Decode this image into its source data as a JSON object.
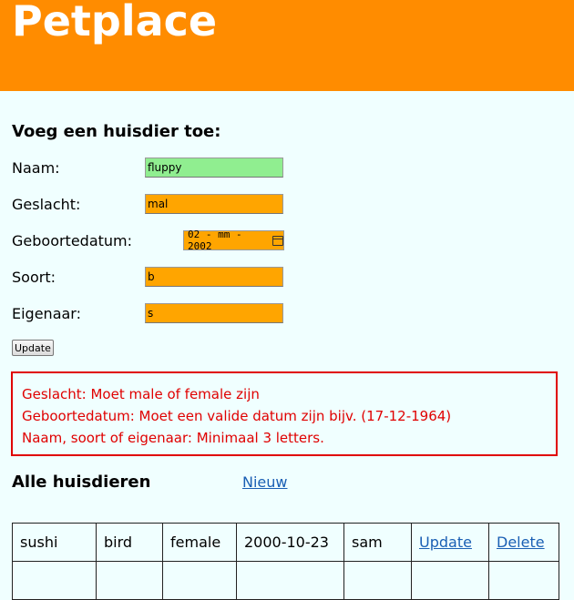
{
  "header": {
    "title": "Petplace"
  },
  "form": {
    "title": "Voeg een huisdier toe:",
    "fields": [
      {
        "label": "Naam:",
        "value": "fluppy",
        "valid": true
      },
      {
        "label": "Geslacht:",
        "value": "mal",
        "valid": false
      },
      {
        "label": "Geboortedatum:",
        "value": "02 - mm - 2002",
        "valid": false
      },
      {
        "label": "Soort:",
        "value": "b",
        "valid": false
      },
      {
        "label": "Eigenaar:",
        "value": "s",
        "valid": false
      }
    ],
    "submit_label": "Update"
  },
  "errors": [
    "Geslacht: Moet male of female zijn",
    "Geboortedatum: Moet een valide datum zijn bijv. (17-12-1964)",
    "Naam, soort of eigenaar: Minimaal 3 letters."
  ],
  "list": {
    "title": "Alle huisdieren",
    "new_link": "Nieuw",
    "rows": [
      {
        "name": "sushi",
        "species": "bird",
        "gender": "female",
        "birthdate": "2000-10-23",
        "owner": "sam",
        "update": "Update",
        "delete": "Delete"
      }
    ]
  },
  "colors": {
    "header_bg": "#ff8c00",
    "page_bg": "#f0ffff",
    "invalid_field": "#ffa500",
    "valid_field": "#90ee90",
    "error": "#e00000",
    "link": "#1a5fb4"
  }
}
